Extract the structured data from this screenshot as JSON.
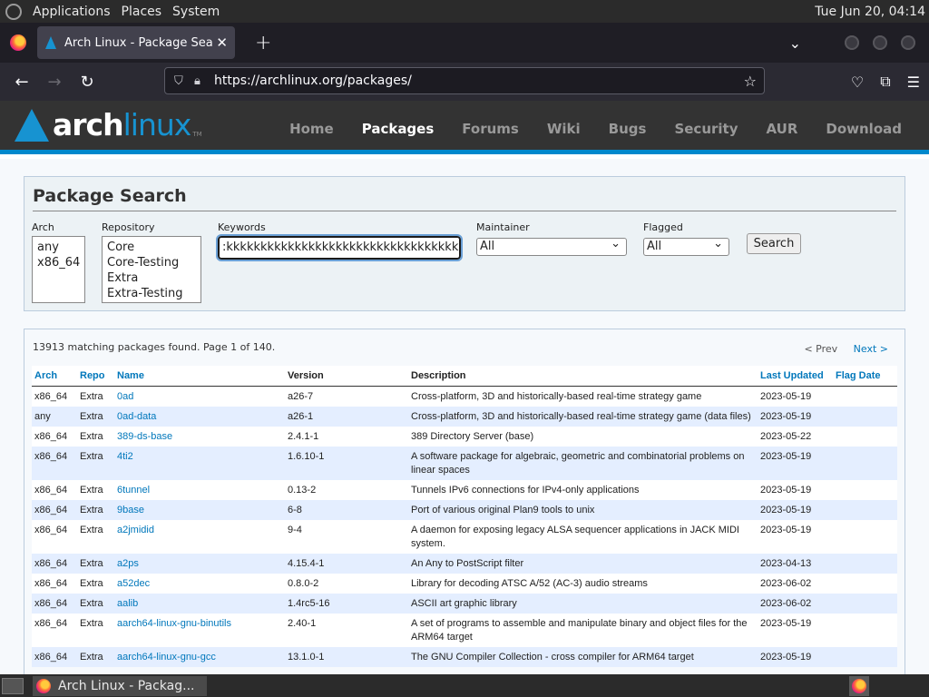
{
  "panel": {
    "menus": [
      "Applications",
      "Places",
      "System"
    ],
    "clock": "Tue Jun 20, 04:14"
  },
  "browser": {
    "tab_title": "Arch Linux - Package Search",
    "url": "https://archlinux.org/packages/"
  },
  "site": {
    "logo_text_1": "arch",
    "logo_text_2": "linux",
    "logo_tm": "TM",
    "nav": [
      "Home",
      "Packages",
      "Forums",
      "Wiki",
      "Bugs",
      "Security",
      "AUR",
      "Download"
    ],
    "active_nav": "Packages"
  },
  "search": {
    "title": "Package Search",
    "arch_label": "Arch",
    "arch_options": [
      "any",
      "x86_64"
    ],
    "repo_label": "Repository",
    "repo_options": [
      "Core",
      "Core-Testing",
      "Extra",
      "Extra-Testing"
    ],
    "keywords_label": "Keywords",
    "keywords_value": ":kkkkkkkkkkkkkkkkkkkkkkkkkkkkkkkkkkkkkkkk",
    "maintainer_label": "Maintainer",
    "maintainer_value": "All",
    "flagged_label": "Flagged",
    "flagged_value": "All",
    "search_button": "Search"
  },
  "results": {
    "summary": "13913 matching packages found. Page 1 of 140.",
    "prev": "< Prev",
    "next": "Next >",
    "columns": [
      "Arch",
      "Repo",
      "Name",
      "Version",
      "Description",
      "Last Updated",
      "Flag Date"
    ],
    "rows": [
      [
        "x86_64",
        "Extra",
        "0ad",
        "a26-7",
        "Cross-platform, 3D and historically-based real-time strategy game",
        "2023-05-19",
        ""
      ],
      [
        "any",
        "Extra",
        "0ad-data",
        "a26-1",
        "Cross-platform, 3D and historically-based real-time strategy game (data files)",
        "2023-05-19",
        ""
      ],
      [
        "x86_64",
        "Extra",
        "389-ds-base",
        "2.4.1-1",
        "389 Directory Server (base)",
        "2023-05-22",
        ""
      ],
      [
        "x86_64",
        "Extra",
        "4ti2",
        "1.6.10-1",
        "A software package for algebraic, geometric and combinatorial problems on linear spaces",
        "2023-05-19",
        ""
      ],
      [
        "x86_64",
        "Extra",
        "6tunnel",
        "0.13-2",
        "Tunnels IPv6 connections for IPv4-only applications",
        "2023-05-19",
        ""
      ],
      [
        "x86_64",
        "Extra",
        "9base",
        "6-8",
        "Port of various original Plan9 tools to unix",
        "2023-05-19",
        ""
      ],
      [
        "x86_64",
        "Extra",
        "a2jmidid",
        "9-4",
        "A daemon for exposing legacy ALSA sequencer applications in JACK MIDI system.",
        "2023-05-19",
        ""
      ],
      [
        "x86_64",
        "Extra",
        "a2ps",
        "4.15.4-1",
        "An Any to PostScript filter",
        "2023-04-13",
        ""
      ],
      [
        "x86_64",
        "Extra",
        "a52dec",
        "0.8.0-2",
        "Library for decoding ATSC A/52 (AC-3) audio streams",
        "2023-06-02",
        ""
      ],
      [
        "x86_64",
        "Extra",
        "aalib",
        "1.4rc5-16",
        "ASCII art graphic library",
        "2023-06-02",
        ""
      ],
      [
        "x86_64",
        "Extra",
        "aarch64-linux-gnu-binutils",
        "2.40-1",
        "A set of programs to assemble and manipulate binary and object files for the ARM64 target",
        "2023-05-19",
        ""
      ],
      [
        "x86_64",
        "Extra",
        "aarch64-linux-gnu-gcc",
        "13.1.0-1",
        "The GNU Compiler Collection - cross compiler for ARM64 target",
        "2023-05-19",
        ""
      ]
    ]
  },
  "taskbar": {
    "task_title": "Arch Linux - Packag..."
  }
}
